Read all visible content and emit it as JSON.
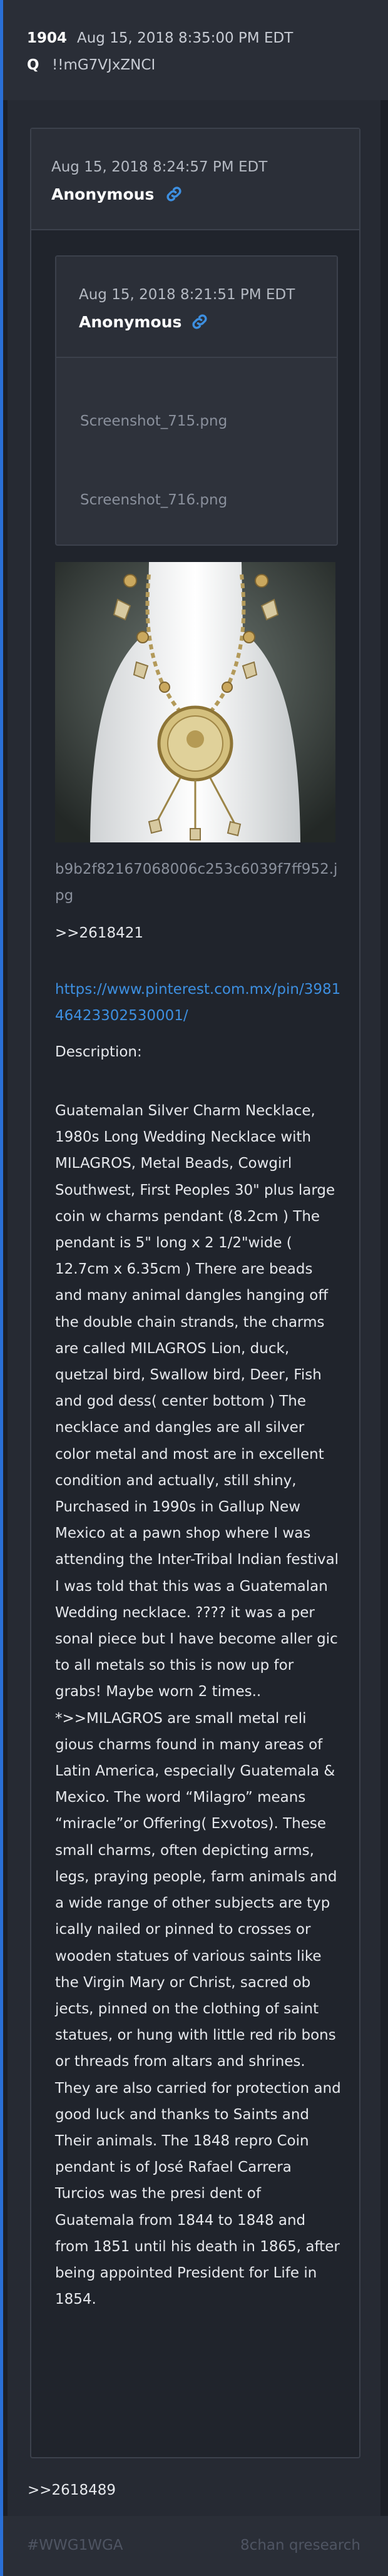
{
  "header": {
    "post_number": "1904",
    "date": "Aug 15, 2018 8:35:00 PM EDT",
    "q_label": "Q",
    "tripcode": "!!mG7VJxZNCI"
  },
  "quoted_post": {
    "date": "Aug 15, 2018 8:24:57 PM EDT",
    "author": "Anonymous",
    "inner_post": {
      "date": "Aug 15, 2018 8:21:51 PM EDT",
      "author": "Anonymous",
      "files": [
        "Screenshot_715.png",
        "Screenshot_716.png"
      ]
    },
    "image_filename": "b9b2f82167068006c253c6039f7ff952.jpg",
    "reply_reference": ">>2618421",
    "link": "https://www.pinterest.com.mx/pin/398146423302530001/",
    "description_label": "Description:",
    "description": "Guatemalan Silver Charm Necklace, 1980s Long Wedding Necklace with MILAGROS, Metal Beads, Cowgirl Southwest, First Peoples 30\" plus large coin w charms pendant (​8.2cm ) The pendant is 5\" long x 2 1/2\"wide ( 12.7cm x 6.35cm ) There are beads and many animal dangles hanging off the double chain strands, the charms are called MILAGROS Lion, duck, quetzal bird, Swallow bird, Deer, Fish and god dess( center bottom ) The necklace and dangles are all silver color metal and most are in excellent condition and actually, still shiny, Purchased in 1990s in Gallup New Mexico at a pawn shop where I was attending the Inter-Tribal Indian festival I was told that this was a Guatemalan Wedding necklace. ???? it was a per sonal piece but I have become aller gic to all metals so this is now up for grabs! Maybe worn 2 times.. *>>MILAGROS are small metal reli gious charms found in many areas of Latin America, especially Guatemala & Mexico. The word “Milagro” means “miracle”or Offering( Exvotos). These small charms, often depicting arms, legs, praying people, farm animals and a wide range of other subjects are typ ically nailed or pinned to crosses or wooden statues of various saints like the Virgin Mary or Christ, sacred ob jects, pinned on the clothing of saint statues, or hung with little red rib bons or threads from altars and shrines. They are also carried for protection and good luck and thanks to Saints and Their animals. The 1848 repro Coin pendant is of José Rafael Carrera Turcios was the presi dent of Guatemala from 1844 to 1848 and from 1851 until his death in 1865, after being appointed President for Life in 1854."
  },
  "post_body": {
    "reply_reference": ">>2618489"
  },
  "footer": {
    "hashtag": "#WWG1WGA",
    "board": "8chan qresearch"
  },
  "icons": {
    "author_link": "link-icon"
  },
  "colors": {
    "accent": "#2a6fd6",
    "link": "#3d8fe0",
    "background": "#1c1f26"
  }
}
